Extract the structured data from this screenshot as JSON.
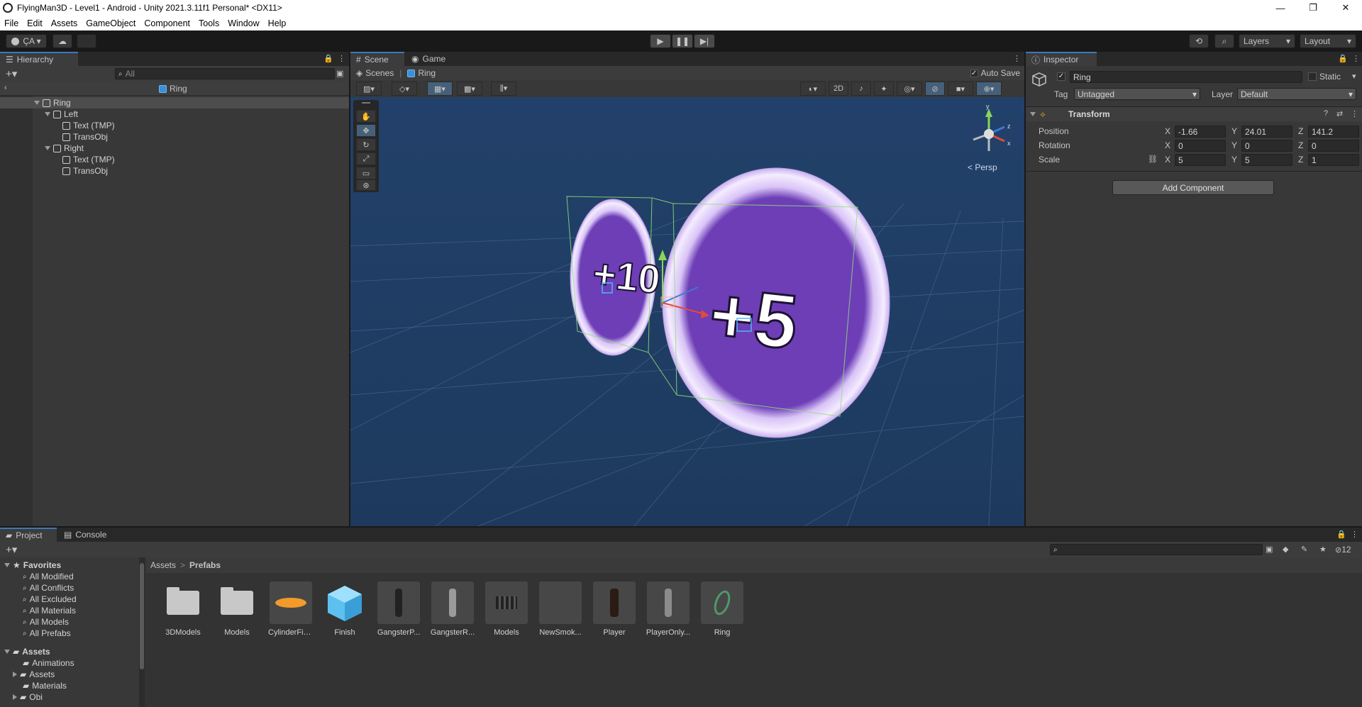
{
  "window": {
    "title": "FlyingMan3D - Level1 - Android - Unity 2021.3.11f1 Personal* <DX11>",
    "controls": [
      "—",
      "❐",
      "✕"
    ]
  },
  "menu": [
    "File",
    "Edit",
    "Assets",
    "GameObject",
    "Component",
    "Tools",
    "Window",
    "Help"
  ],
  "toolbar": {
    "account": "ÇA ▾",
    "layers": "Layers",
    "layout": "Layout"
  },
  "hierarchy": {
    "tab": "Hierarchy",
    "search_placeholder": "All",
    "context": "Ring",
    "items": [
      {
        "label": "Ring",
        "depth": 0,
        "expanded": true
      },
      {
        "label": "Left",
        "depth": 1,
        "expanded": true
      },
      {
        "label": "Text (TMP)",
        "depth": 2
      },
      {
        "label": "TransObj",
        "depth": 2
      },
      {
        "label": "Right",
        "depth": 1,
        "expanded": true
      },
      {
        "label": "Text (TMP)",
        "depth": 2
      },
      {
        "label": "TransObj",
        "depth": 2
      }
    ]
  },
  "scene": {
    "tabs": [
      "Scene",
      "Game"
    ],
    "breadcrumb": [
      "Scenes",
      "Ring"
    ],
    "auto_save": "Auto Save",
    "mode_2d": "2D",
    "persp": "< Persp",
    "ring_left_text": "+10",
    "ring_right_text": "+5",
    "gizmo_axes": {
      "y": "y",
      "z": "z",
      "x": "x"
    }
  },
  "inspector": {
    "tab": "Inspector",
    "object_name": "Ring",
    "static_label": "Static",
    "tag_label": "Tag",
    "tag_value": "Untagged",
    "layer_label": "Layer",
    "layer_value": "Default",
    "transform_title": "Transform",
    "position_label": "Position",
    "rotation_label": "Rotation",
    "scale_label": "Scale",
    "position": {
      "x": "-1.66",
      "y": "24.01",
      "z": "141.2"
    },
    "rotation": {
      "x": "0",
      "y": "0",
      "z": "0"
    },
    "scale": {
      "x": "5",
      "y": "5",
      "z": "1"
    },
    "axis_labels": {
      "x": "X",
      "y": "Y",
      "z": "Z"
    },
    "add_component": "Add Component"
  },
  "project": {
    "tabs": [
      "Project",
      "Console"
    ],
    "hidden_count": "12",
    "favorites_label": "Favorites",
    "favorites": [
      "All Modified",
      "All Conflicts",
      "All Excluded",
      "All Materials",
      "All Models",
      "All Prefabs"
    ],
    "assets_label": "Assets",
    "asset_folders": [
      "Animations",
      "Assets",
      "Materials",
      "Obi"
    ],
    "breadcrumb": [
      "Assets",
      "Prefabs"
    ],
    "items": [
      "3DModels",
      "Models",
      "CylinderFin...",
      "Finish",
      "GangsterP...",
      "GangsterR...",
      "Models",
      "NewSmok...",
      "Player",
      "PlayerOnly...",
      "Ring"
    ]
  },
  "colors": {
    "accent": "#3a79bb",
    "scene_sky": "#2a4a72",
    "ring_purple": "#6b3fb4",
    "ring_edge": "#e6d4ff"
  }
}
